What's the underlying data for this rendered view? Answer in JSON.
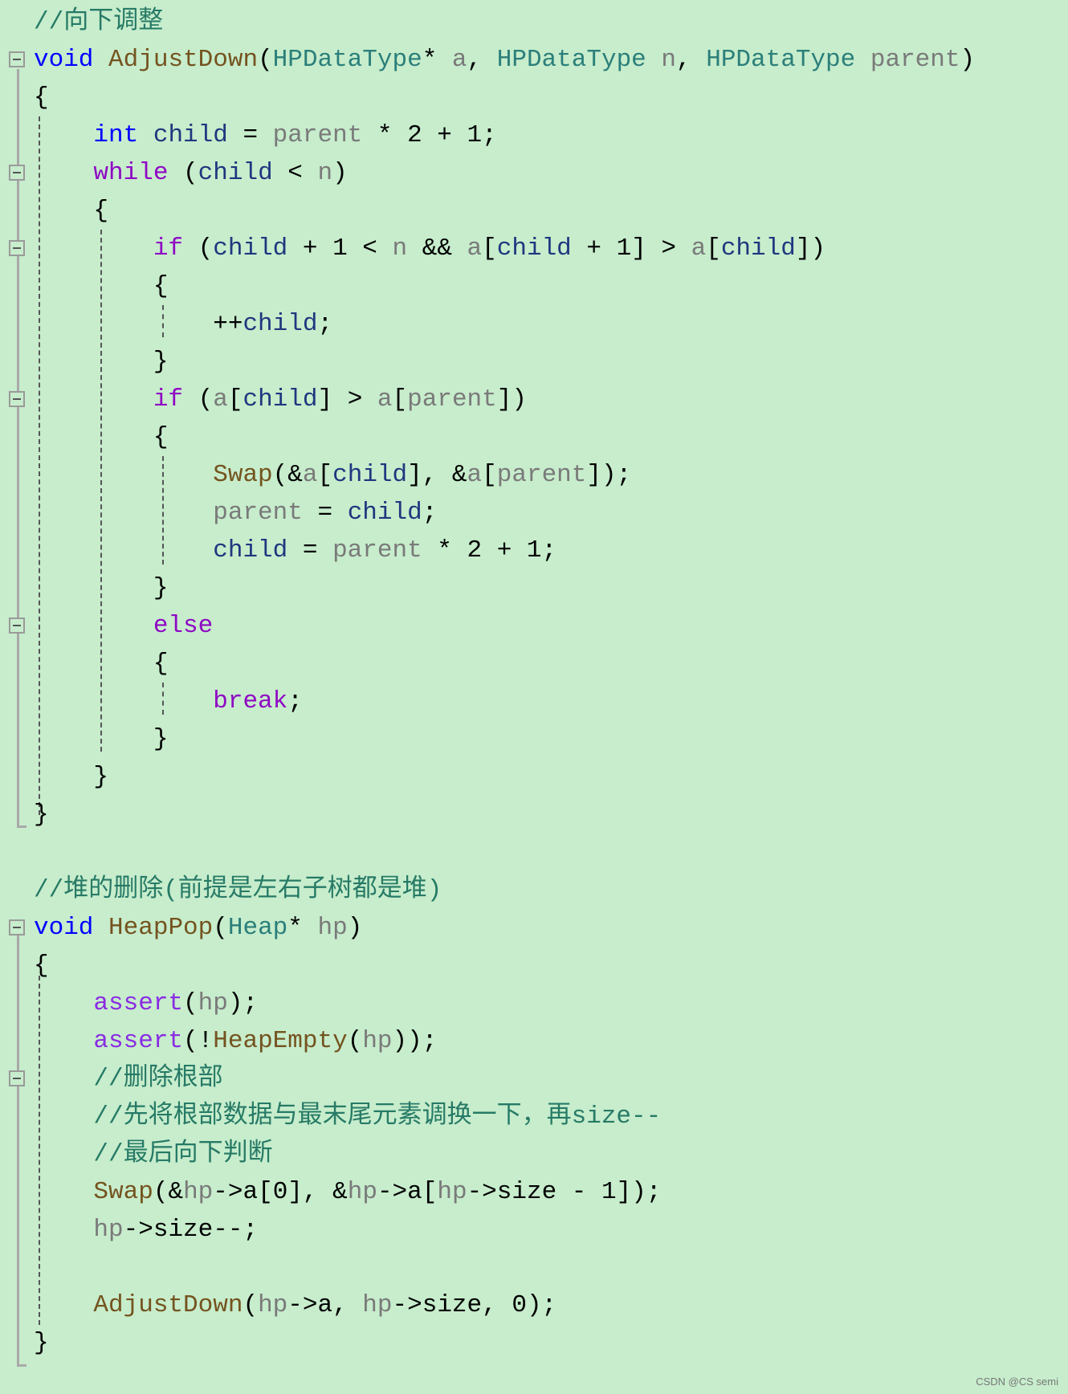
{
  "editor": {
    "lines": [
      [
        [
          "cm",
          "//向下调整"
        ]
      ],
      [
        [
          "kw",
          "void"
        ],
        [
          "p",
          " "
        ],
        [
          "fn",
          "AdjustDown"
        ],
        [
          "p",
          "("
        ],
        [
          "ty",
          "HPDataType"
        ],
        [
          "p",
          "* "
        ],
        [
          "prm",
          "a"
        ],
        [
          "p",
          ", "
        ],
        [
          "ty",
          "HPDataType"
        ],
        [
          "p",
          " "
        ],
        [
          "prm",
          "n"
        ],
        [
          "p",
          ", "
        ],
        [
          "ty",
          "HPDataType"
        ],
        [
          "p",
          " "
        ],
        [
          "prm",
          "parent"
        ],
        [
          "p",
          ")"
        ]
      ],
      [
        [
          "p",
          "{"
        ]
      ],
      [
        [
          "p",
          "    "
        ],
        [
          "kw",
          "int"
        ],
        [
          "p",
          " "
        ],
        [
          "loc",
          "child"
        ],
        [
          "p",
          " = "
        ],
        [
          "prm",
          "parent"
        ],
        [
          "p",
          " * 2 + 1;"
        ]
      ],
      [
        [
          "p",
          "    "
        ],
        [
          "ctl",
          "while"
        ],
        [
          "p",
          " ("
        ],
        [
          "loc",
          "child"
        ],
        [
          "p",
          " < "
        ],
        [
          "prm",
          "n"
        ],
        [
          "p",
          ")"
        ]
      ],
      [
        [
          "p",
          "    {"
        ]
      ],
      [
        [
          "p",
          "        "
        ],
        [
          "ctl",
          "if"
        ],
        [
          "p",
          " ("
        ],
        [
          "loc",
          "child"
        ],
        [
          "p",
          " + 1 < "
        ],
        [
          "prm",
          "n"
        ],
        [
          "p",
          " && "
        ],
        [
          "prm",
          "a"
        ],
        [
          "p",
          "["
        ],
        [
          "loc",
          "child"
        ],
        [
          "p",
          " + 1] > "
        ],
        [
          "prm",
          "a"
        ],
        [
          "p",
          "["
        ],
        [
          "loc",
          "child"
        ],
        [
          "p",
          "])"
        ]
      ],
      [
        [
          "p",
          "        {"
        ]
      ],
      [
        [
          "p",
          "            ++"
        ],
        [
          "loc",
          "child"
        ],
        [
          "p",
          ";"
        ]
      ],
      [
        [
          "p",
          "        }"
        ]
      ],
      [
        [
          "p",
          "        "
        ],
        [
          "ctl",
          "if"
        ],
        [
          "p",
          " ("
        ],
        [
          "prm",
          "a"
        ],
        [
          "p",
          "["
        ],
        [
          "loc",
          "child"
        ],
        [
          "p",
          "] > "
        ],
        [
          "prm",
          "a"
        ],
        [
          "p",
          "["
        ],
        [
          "prm",
          "parent"
        ],
        [
          "p",
          "])"
        ]
      ],
      [
        [
          "p",
          "        {"
        ]
      ],
      [
        [
          "p",
          "            "
        ],
        [
          "fn",
          "Swap"
        ],
        [
          "p",
          "(&"
        ],
        [
          "prm",
          "a"
        ],
        [
          "p",
          "["
        ],
        [
          "loc",
          "child"
        ],
        [
          "p",
          "], &"
        ],
        [
          "prm",
          "a"
        ],
        [
          "p",
          "["
        ],
        [
          "prm",
          "parent"
        ],
        [
          "p",
          "]);"
        ]
      ],
      [
        [
          "p",
          "            "
        ],
        [
          "prm",
          "parent"
        ],
        [
          "p",
          " = "
        ],
        [
          "loc",
          "child"
        ],
        [
          "p",
          ";"
        ]
      ],
      [
        [
          "p",
          "            "
        ],
        [
          "loc",
          "child"
        ],
        [
          "p",
          " = "
        ],
        [
          "prm",
          "parent"
        ],
        [
          "p",
          " * 2 + 1;"
        ]
      ],
      [
        [
          "p",
          "        }"
        ]
      ],
      [
        [
          "p",
          "        "
        ],
        [
          "ctl",
          "else"
        ]
      ],
      [
        [
          "p",
          "        {"
        ]
      ],
      [
        [
          "p",
          "            "
        ],
        [
          "ctl",
          "break"
        ],
        [
          "p",
          ";"
        ]
      ],
      [
        [
          "p",
          "        }"
        ]
      ],
      [
        [
          "p",
          "    }"
        ]
      ],
      [
        [
          "p",
          "}"
        ]
      ],
      [],
      [
        [
          "cm",
          "//堆的删除(前提是左右子树都是堆)"
        ]
      ],
      [
        [
          "kw",
          "void"
        ],
        [
          "p",
          " "
        ],
        [
          "fn",
          "HeapPop"
        ],
        [
          "p",
          "("
        ],
        [
          "ty",
          "Heap"
        ],
        [
          "p",
          "* "
        ],
        [
          "prm",
          "hp"
        ],
        [
          "p",
          ")"
        ]
      ],
      [
        [
          "p",
          "{"
        ]
      ],
      [
        [
          "p",
          "    "
        ],
        [
          "mac",
          "assert"
        ],
        [
          "p",
          "("
        ],
        [
          "prm",
          "hp"
        ],
        [
          "p",
          ");"
        ]
      ],
      [
        [
          "p",
          "    "
        ],
        [
          "mac",
          "assert"
        ],
        [
          "p",
          "(!"
        ],
        [
          "fn",
          "HeapEmpty"
        ],
        [
          "p",
          "("
        ],
        [
          "prm",
          "hp"
        ],
        [
          "p",
          "));"
        ]
      ],
      [
        [
          "p",
          "    "
        ],
        [
          "cm",
          "//删除根部"
        ]
      ],
      [
        [
          "p",
          "    "
        ],
        [
          "cm",
          "//先将根部数据与最末尾元素调换一下，再size--"
        ]
      ],
      [
        [
          "p",
          "    "
        ],
        [
          "cm",
          "//最后向下判断"
        ]
      ],
      [
        [
          "p",
          "    "
        ],
        [
          "fn",
          "Swap"
        ],
        [
          "p",
          "(&"
        ],
        [
          "prm",
          "hp"
        ],
        [
          "p",
          "->a[0], &"
        ],
        [
          "prm",
          "hp"
        ],
        [
          "p",
          "->a["
        ],
        [
          "prm",
          "hp"
        ],
        [
          "p",
          "->size - 1]);"
        ]
      ],
      [
        [
          "p",
          "    "
        ],
        [
          "prm",
          "hp"
        ],
        [
          "p",
          "->size--;"
        ]
      ],
      [],
      [
        [
          "p",
          "    "
        ],
        [
          "fn",
          "AdjustDown"
        ],
        [
          "p",
          "("
        ],
        [
          "prm",
          "hp"
        ],
        [
          "p",
          "->a, "
        ],
        [
          "prm",
          "hp"
        ],
        [
          "p",
          "->size, 0);"
        ]
      ],
      [
        [
          "p",
          "}"
        ]
      ]
    ],
    "fold_lines": [
      1,
      4,
      6,
      10,
      16,
      24,
      28
    ]
  },
  "watermark": "CSDN @CS semi",
  "colors": {
    "background": "#c7edcc",
    "keyword": "#0000ff",
    "control": "#8f08c4",
    "function": "#74531f",
    "type": "#2b7f7a",
    "parameter": "#7a7a7a",
    "local": "#1f377f",
    "comment": "#267a66"
  }
}
